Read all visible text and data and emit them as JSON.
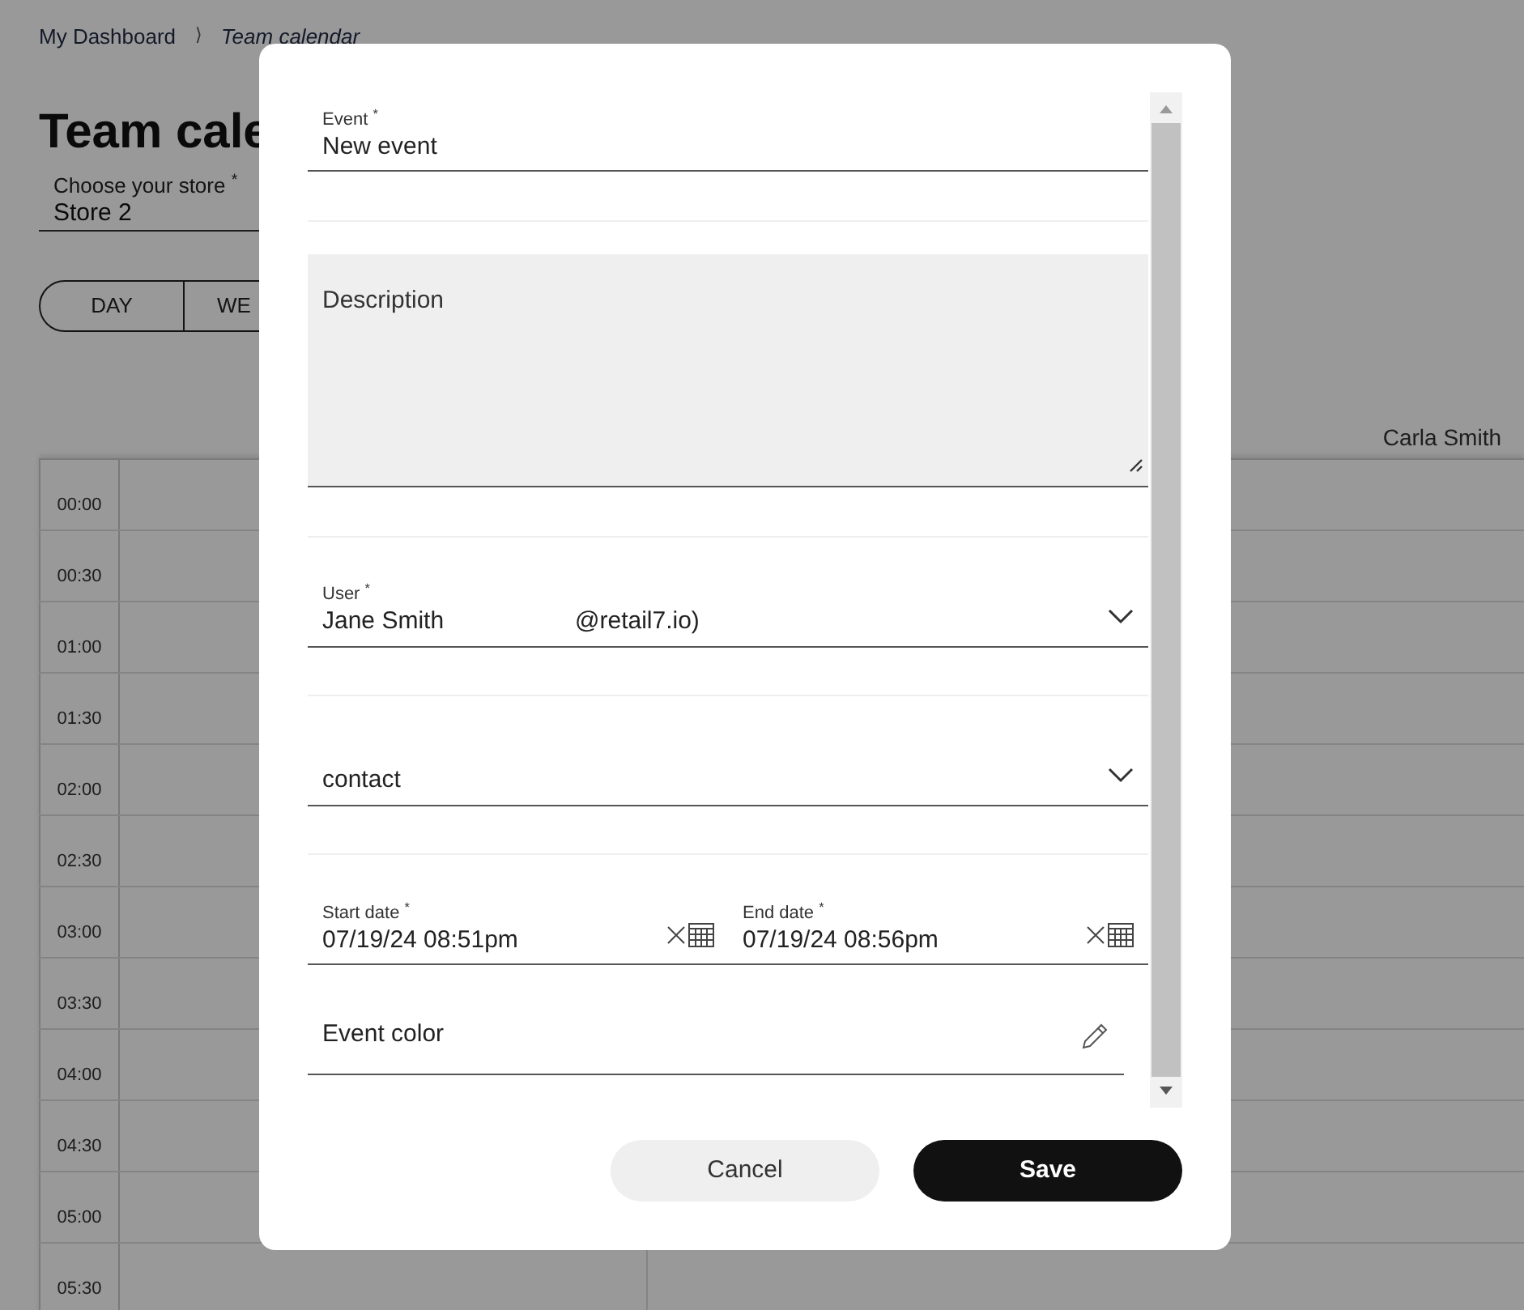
{
  "breadcrumb": {
    "items": [
      "My Dashboard",
      "Team calendar"
    ],
    "separator": "⟩"
  },
  "page_title": "Team cale",
  "store_field": {
    "label": "Choose your store $^{*}$",
    "value": "Store 2"
  },
  "view_tabs": [
    "DAY",
    "WE"
  ],
  "calendar": {
    "column_header": "Carla Smith",
    "times": [
      "00:00",
      "00:30",
      "01:00",
      "01:30",
      "02:00",
      "02:30",
      "03:00",
      "03:30",
      "04:00",
      "04:30",
      "05:00",
      "05:30"
    ]
  },
  "dialog": {
    "fields": [
      {
        "kind": "text",
        "label": "Event $^{*}$",
        "value": "New event"
      },
      {
        "kind": "textarea",
        "placeholder": "Description"
      },
      {
        "kind": "select",
        "label": "User $^{*}$",
        "value": "Jane Smith",
        "value_2": "@retail7.io)"
      },
      {
        "kind": "select",
        "placeholder": "contact"
      },
      {
        "kind": "dates",
        "dates": [
          {
            "label": "Start date $^{*}$",
            "value": "07/19/24 08:51pm"
          },
          {
            "label": "End date $^{*}$",
            "value": "07/19/24 08:56pm"
          }
        ]
      },
      {
        "kind": "color",
        "placeholder": "Event color"
      }
    ],
    "buttons": [
      {
        "label": "Cancel",
        "kind": "secondary"
      },
      {
        "label": "Save",
        "kind": "primary"
      }
    ]
  }
}
